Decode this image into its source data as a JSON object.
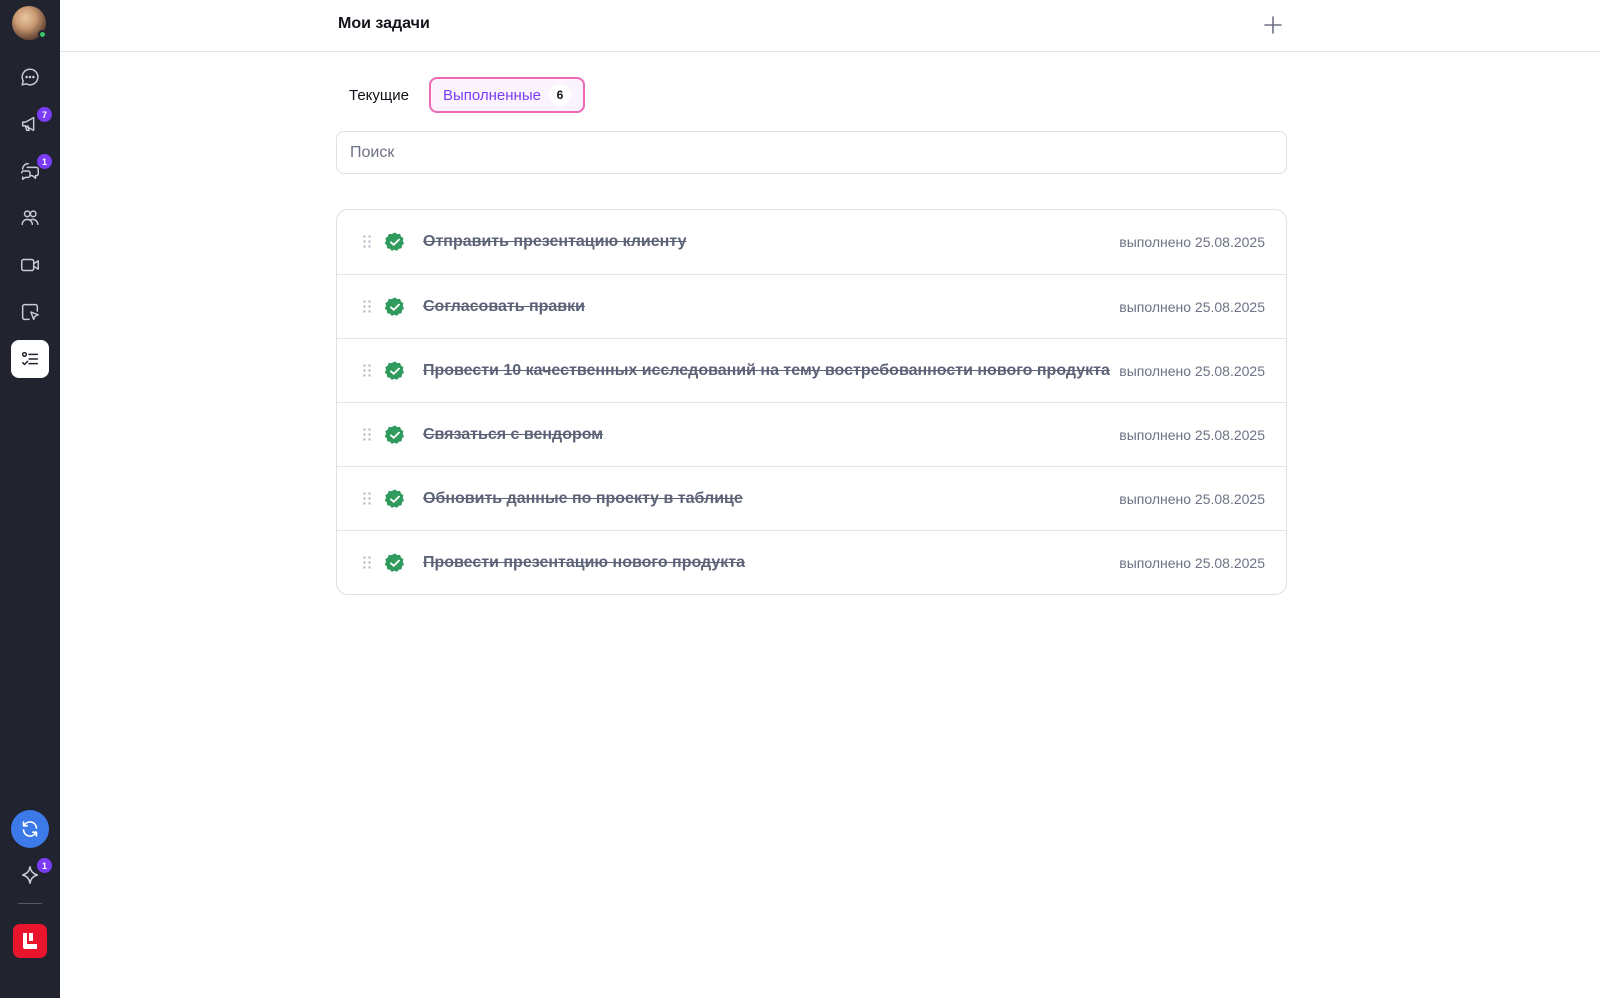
{
  "header": {
    "title": "Мои задачи"
  },
  "sidebar": {
    "items": [
      {
        "icon": "chat-icon",
        "badge": ""
      },
      {
        "icon": "megaphone-icon",
        "badge": "7"
      },
      {
        "icon": "comments-icon",
        "badge": "1"
      },
      {
        "icon": "team-icon",
        "badge": ""
      },
      {
        "icon": "video-icon",
        "badge": ""
      },
      {
        "icon": "whiteboard-icon",
        "badge": ""
      },
      {
        "icon": "tasks-icon",
        "badge": "",
        "active": true
      }
    ],
    "sparkle_badge": "1"
  },
  "tabs": {
    "current_label": "Текущие",
    "done_label": "Выполненные",
    "done_count": "6"
  },
  "search": {
    "placeholder": "Поиск"
  },
  "tasks": [
    {
      "title": "Отправить презентацию клиенту",
      "date": "выполнено 25.08.2025"
    },
    {
      "title": "Согласовать правки",
      "date": "выполнено 25.08.2025"
    },
    {
      "title": "Провести 10 качественных исследований на тему востребованности нового продукта",
      "date": "выполнено 25.08.2025"
    },
    {
      "title": "Связаться с вендором",
      "date": "выполнено 25.08.2025"
    },
    {
      "title": "Обновить данные по проекту в таблице",
      "date": "выполнено 25.08.2025"
    },
    {
      "title": "Провести презентацию нового продукта",
      "date": "выполнено 25.08.2025"
    }
  ],
  "colors": {
    "sidebar_bg": "#21242f",
    "accent_purple": "#7a3cf5",
    "tab_border_pink": "#ec69b5",
    "check_green": "#2f9b5c",
    "sync_blue": "#3b7ae8",
    "brand_red": "#e8152d"
  }
}
